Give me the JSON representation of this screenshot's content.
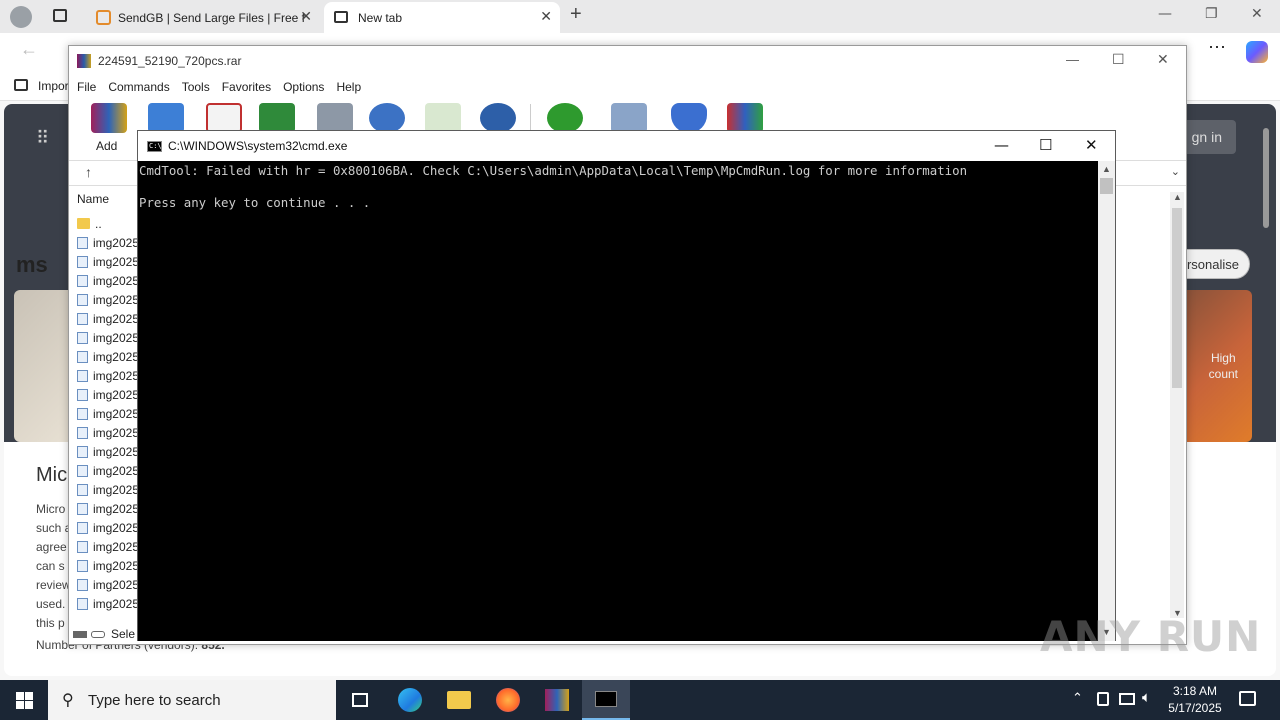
{
  "browser": {
    "tabs": [
      {
        "title": "SendGB | Send Large Files | Free f",
        "active": false
      },
      {
        "title": "New tab",
        "active": true
      }
    ],
    "bookmark_partial": "Impor",
    "new_tab": {
      "signin_label": "gn in",
      "msn_label": "ms",
      "personalise_label": "rsonalise",
      "card_text_line1": "High",
      "card_text_line2": "count",
      "privacy_title": "Mic",
      "privacy_lines": [
        "Micro",
        "such a",
        "agree",
        "can s",
        "review",
        "used.",
        "this p"
      ],
      "vendors_label": "Number of Partners (vendors):",
      "vendors_count": "852."
    }
  },
  "winrar": {
    "title": "224591_52190_720pcs.rar",
    "menu": [
      "File",
      "Commands",
      "Tools",
      "Favorites",
      "Options",
      "Help"
    ],
    "add_label": "Add",
    "column_name": "Name",
    "parent_entry": "..",
    "files": [
      "img2025",
      "img2025",
      "img2025",
      "img2025",
      "img2025",
      "img2025",
      "img2025",
      "img2025",
      "img2025",
      "img2025",
      "img2025",
      "img2025",
      "img2025",
      "img2025",
      "img2025",
      "img2025",
      "img2025",
      "img2025",
      "img2025",
      "img2025"
    ],
    "status": "Sele"
  },
  "cmd": {
    "title": "C:\\WINDOWS\\system32\\cmd.exe",
    "line1": "CmdTool: Failed with hr = 0x800106BA. Check C:\\Users\\admin\\AppData\\Local\\Temp\\MpCmdRun.log for more information",
    "line2": "",
    "line3": "Press any key to continue . . ."
  },
  "watermark": "ANY RUN",
  "taskbar": {
    "search_placeholder": "Type here to search",
    "time": "3:18 AM",
    "date": "5/17/2025"
  },
  "colors": {
    "taskbar_bg": "#1b2635",
    "cmd_bg": "#000000",
    "cmd_text": "#cccccc",
    "accent": "#76b9ed"
  }
}
